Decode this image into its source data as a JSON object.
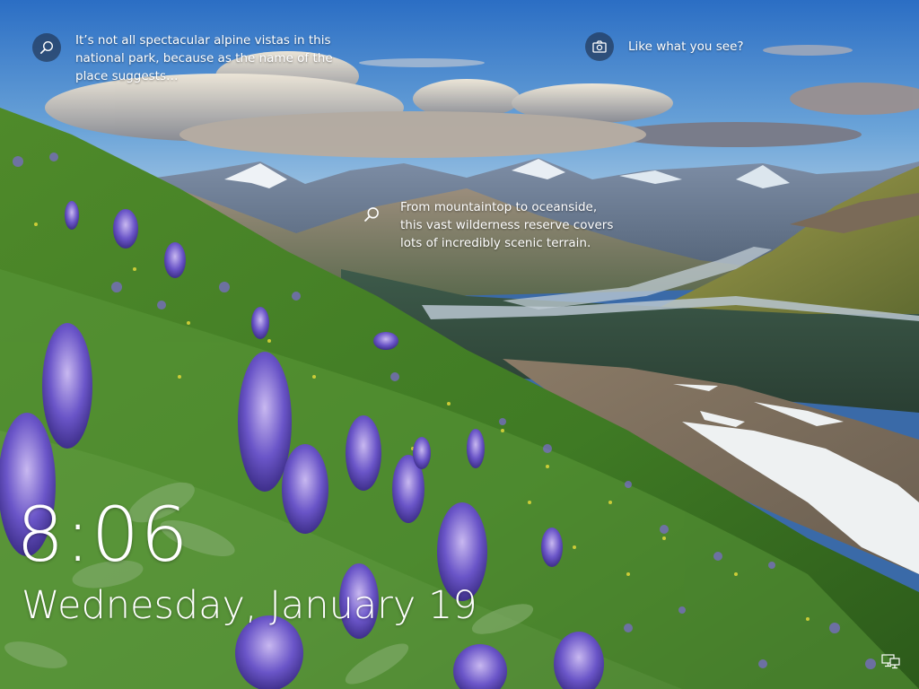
{
  "lock_screen": {
    "hint_1": {
      "icon": "search-icon",
      "text": "It’s not all spectacular alpine vistas in this national park, because as the name of the place suggests…"
    },
    "hint_2": {
      "icon": "search-icon",
      "text": "From mountaintop to oceanside, this vast wilderness reserve covers lots of incredibly scenic terrain."
    },
    "feedback": {
      "icon": "camera-icon",
      "text": "Like what you see?"
    },
    "time": "8:06",
    "date": "Wednesday, January 19",
    "network_icon": "network-icon"
  },
  "colors": {
    "text": "#ffffff",
    "icon_circle": "#19233788"
  }
}
